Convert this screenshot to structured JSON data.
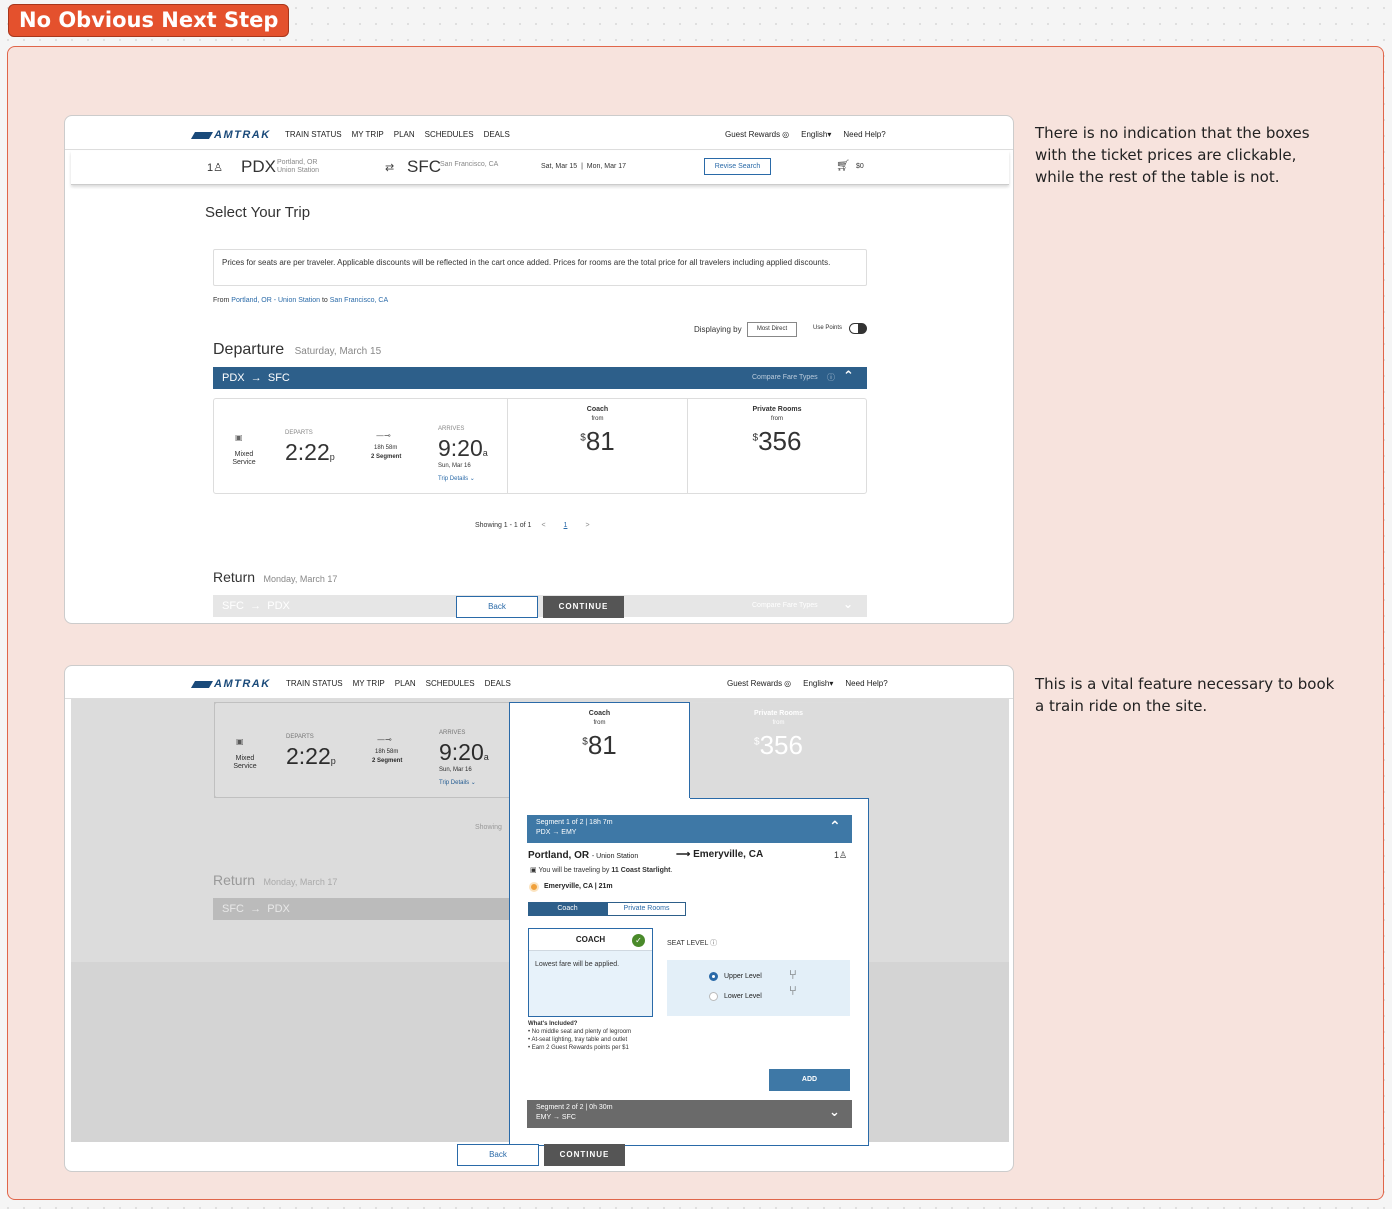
{
  "label": "No Obvious Next Step",
  "notes": {
    "n1": "There is no indication that the boxes with the ticket prices are clickable, while the rest of the table is not.",
    "n2": "This is a vital feature necessary to book a train ride on the site."
  },
  "nav": {
    "logo": "AMTRAK",
    "items": [
      "TRAIN STATUS",
      "MY TRIP",
      "PLAN",
      "SCHEDULES",
      "DEALS"
    ],
    "rewards": "Guest Rewards",
    "lang": "English",
    "help": "Need Help?"
  },
  "search": {
    "travelers": "1",
    "from": "PDX",
    "from_city": "Portland, OR",
    "from_station": "Union Station",
    "to": "SFC",
    "to_city": "San Francisco, CA",
    "dates": "Sat, Mar 15  |  Mon, Mar 17",
    "revise": "Revise Search",
    "cart": "$0"
  },
  "page": {
    "title": "Select Your Trip",
    "notice": "Prices for seats are per traveler. Applicable discounts will be reflected in the cart once added. Prices for rooms are the total price for all travelers including applied discounts.",
    "from_label": "From",
    "from_link": "Portland, OR - Union Station",
    "to_label": "to",
    "to_link": "San Francisco, CA",
    "displaying_by": "Displaying by",
    "sort": "Most Direct",
    "use_points": "Use Points"
  },
  "departure": {
    "label": "Departure",
    "date": "Saturday, March 15",
    "route_from": "PDX",
    "route_to": "SFC",
    "compare": "Compare Fare Types"
  },
  "trip": {
    "service": "Mixed Service",
    "departs_label": "DEPARTS",
    "departs_time": "2:22",
    "departs_ap": "p",
    "duration": "18h 58m",
    "segments": "2 Segment",
    "arrives_label": "ARRIVES",
    "arrives_time": "9:20",
    "arrives_ap": "a",
    "arrives_date": "Sun, Mar 16",
    "details": "Trip Details"
  },
  "fares": {
    "coach_label": "Coach",
    "from": "from",
    "coach_price": "81",
    "rooms_label": "Private Rooms",
    "rooms_price": "356",
    "currency": "$"
  },
  "pagination": {
    "showing": "Showing 1 - 1 of 1",
    "page": "1"
  },
  "return": {
    "label": "Return",
    "date": "Monday, March 17",
    "route_from": "SFC",
    "route_to": "PDX"
  },
  "actions": {
    "back": "Back",
    "continue": "CONTINUE"
  },
  "panel": {
    "seg1": "Segment 1 of 2 | 18h 7m",
    "seg1_route": "PDX → EMY",
    "origin": "Portland, OR",
    "origin_station": "- Union Station",
    "dest": "Emeryville, CA",
    "travelers": "1",
    "travel_by_pre": "You will be traveling by",
    "train": "11 Coast Starlight",
    "stop": "Emeryville, CA | 21m",
    "tab_coach": "Coach",
    "tab_rooms": "Private Rooms",
    "coach_title": "COACH",
    "coach_note": "Lowest fare will be applied.",
    "seat_level": "SEAT LEVEL",
    "upper": "Upper Level",
    "lower": "Lower Level",
    "included_title": "What's Included?",
    "included": [
      "No middle seat and plenty of legroom",
      "At-seat lighting, tray table and outlet",
      "Earn 2 Guest Rewards points per $1"
    ],
    "add": "ADD",
    "seg2": "Segment 2 of 2 | 0h 30m",
    "seg2_route": "EMY → SFC"
  }
}
